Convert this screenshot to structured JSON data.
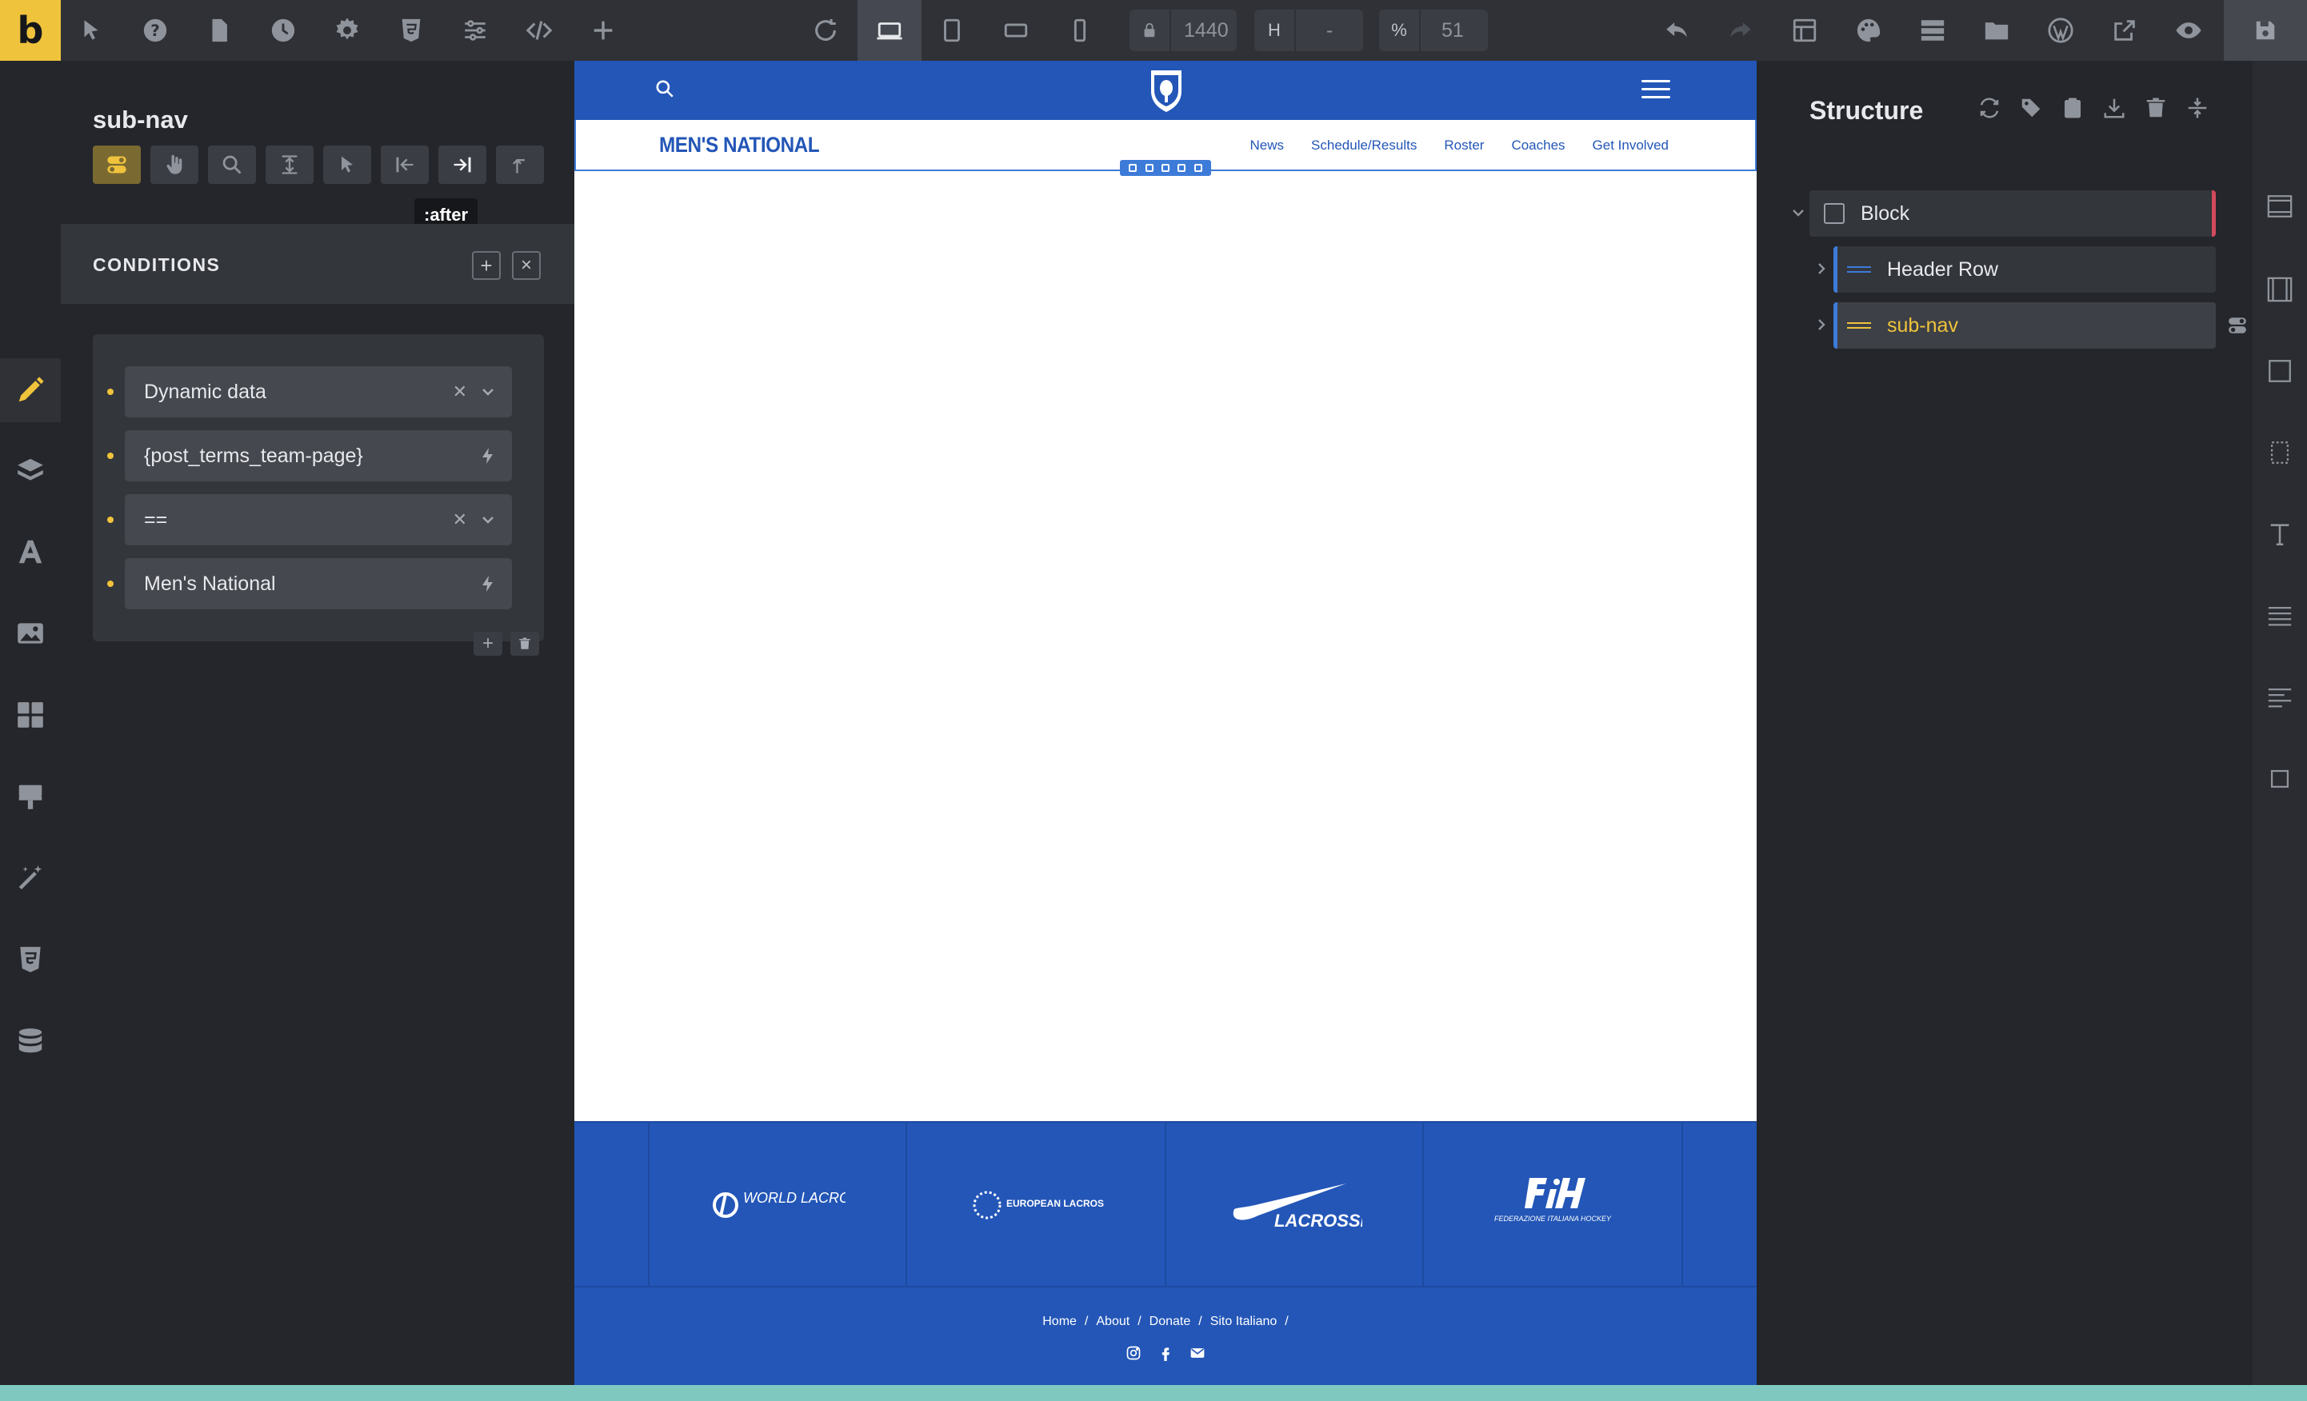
{
  "toolbar": {
    "logo_letter": "b",
    "width_value": "1440",
    "height_label": "H",
    "height_value": "-",
    "zoom_label": "%",
    "zoom_value": "51"
  },
  "panel": {
    "title": "sub-nav",
    "tooltip": ":after",
    "conditions_title": "CONDITIONS",
    "conditions": [
      {
        "value": "Dynamic data",
        "type": "select"
      },
      {
        "value": "{post_terms_team-page}",
        "type": "dynamic"
      },
      {
        "value": "==",
        "type": "select"
      },
      {
        "value": "Men's National",
        "type": "dynamic"
      }
    ]
  },
  "site": {
    "subnav_title": "MEN'S NATIONAL",
    "subnav_links": [
      "News",
      "Schedule/Results",
      "Roster",
      "Coaches",
      "Get Involved"
    ],
    "footer_logos": [
      "WORLD LACROSSE",
      "EUROPEAN LACROSSE FEDERATION",
      "LACROSSE",
      "FEDERAZIONE ITALIANA HOCKEY"
    ],
    "footer_links": [
      "Home",
      "/",
      "About",
      "/",
      "Donate",
      "/",
      "Sito Italiano",
      "/"
    ],
    "brand_color": "#2356b7"
  },
  "structure": {
    "title": "Structure",
    "items": [
      {
        "label": "Block"
      },
      {
        "label": "Header Row"
      },
      {
        "label": "sub-nav"
      }
    ]
  },
  "colors": {
    "accent": "#f0c33c",
    "selection": "#3d7bd9",
    "block_marker": "#d24a5c"
  }
}
